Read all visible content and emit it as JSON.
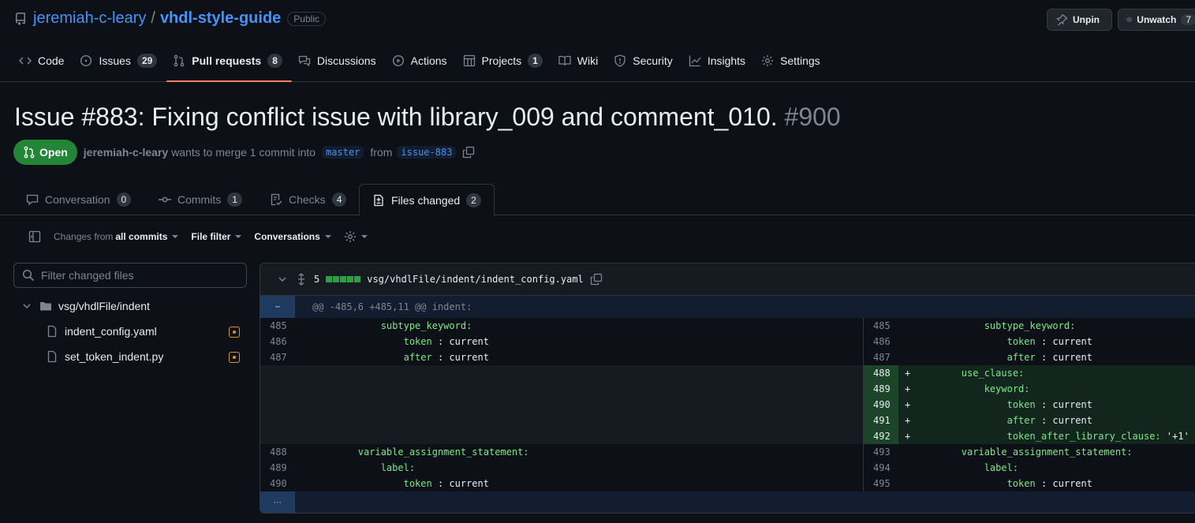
{
  "repo": {
    "owner": "jeremiah-c-leary",
    "separator": "/",
    "name": "vhdl-style-guide",
    "visibility": "Public",
    "unpin_label": "Unpin",
    "unwatch_label": "Unwatch",
    "watch_count": "7"
  },
  "nav": {
    "code": "Code",
    "issues": "Issues",
    "issues_count": "29",
    "pull_requests": "Pull requests",
    "pull_requests_count": "8",
    "discussions": "Discussions",
    "actions": "Actions",
    "projects": "Projects",
    "projects_count": "1",
    "wiki": "Wiki",
    "security": "Security",
    "insights": "Insights",
    "settings": "Settings"
  },
  "pr": {
    "title": "Issue #883: Fixing conflict issue with library_009 and comment_010.",
    "number": "#900",
    "state": "Open",
    "author": "jeremiah-c-leary",
    "merge_text": "wants to merge 1 commit into",
    "base_branch": "master",
    "from_text": "from",
    "head_branch": "issue-883"
  },
  "tabs": {
    "conversation": "Conversation",
    "conversation_count": "0",
    "commits": "Commits",
    "commits_count": "1",
    "checks": "Checks",
    "checks_count": "4",
    "files_changed": "Files changed",
    "files_changed_count": "2"
  },
  "toolbar": {
    "changes_from": "Changes from",
    "all_commits": "all commits",
    "file_filter": "File filter",
    "conversations": "Conversations"
  },
  "sidebar": {
    "filter_placeholder": "Filter changed files",
    "folder": "vsg/vhdlFile/indent",
    "files": [
      "indent_config.yaml",
      "set_token_indent.py"
    ]
  },
  "diff": {
    "change_count": "5",
    "file_path": "vsg/vhdlFile/indent/indent_config.yaml",
    "hunk_header": "@@ -485,6 +485,11 @@ indent:",
    "context_top": [
      {
        "l": "485",
        "r": "485",
        "key": "subtype_keyword:",
        "val": "",
        "indent": "            "
      },
      {
        "l": "486",
        "r": "486",
        "key": "token",
        "val": " : current",
        "indent": "                "
      },
      {
        "l": "487",
        "r": "487",
        "key": "after",
        "val": " : current",
        "indent": "                "
      }
    ],
    "added": [
      {
        "r": "488",
        "key": "use_clause:",
        "val": "",
        "indent": "        "
      },
      {
        "r": "489",
        "key": "keyword:",
        "val": "",
        "indent": "            "
      },
      {
        "r": "490",
        "key": "token",
        "val": " : current",
        "indent": "                "
      },
      {
        "r": "491",
        "key": "after",
        "val": " : current",
        "indent": "                "
      },
      {
        "r": "492",
        "key": "token_after_library_clause:",
        "val": " '+1'",
        "indent": "                "
      }
    ],
    "context_bottom": [
      {
        "l": "488",
        "r": "493",
        "key": "variable_assignment_statement:",
        "val": "",
        "indent": "        "
      },
      {
        "l": "489",
        "r": "494",
        "key": "label:",
        "val": "",
        "indent": "            "
      },
      {
        "l": "490",
        "r": "495",
        "key": "token",
        "val": " : current",
        "indent": "                "
      }
    ],
    "plus_sign": "+"
  }
}
